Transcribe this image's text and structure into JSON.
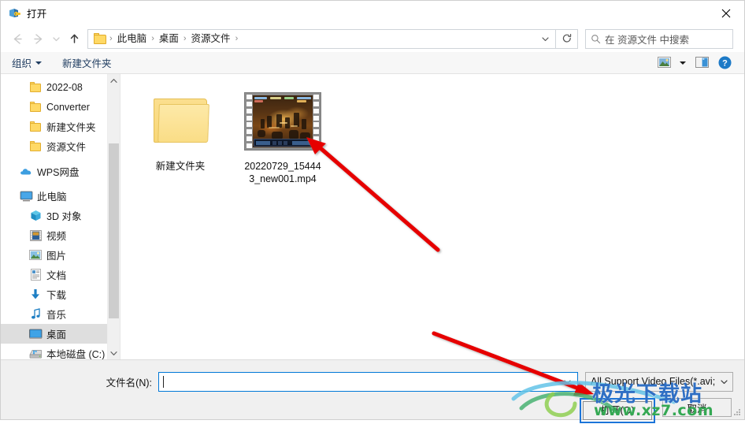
{
  "window": {
    "title": "打开",
    "title_icon": "open-file-icon",
    "close_label": "✕"
  },
  "nav": {
    "back_icon": "arrow-left-icon",
    "forward_icon": "arrow-right-icon",
    "recent_icon": "chevron-down-icon",
    "up_icon": "arrow-up-icon",
    "breadcrumbs": [
      "此电脑",
      "桌面",
      "资源文件"
    ],
    "separator": "›",
    "dropdown_icon": "chevron-down-icon",
    "refresh_icon": "refresh-icon"
  },
  "search": {
    "placeholder": "在 资源文件 中搜索",
    "icon": "search-icon"
  },
  "toolbar": {
    "organize_label": "组织",
    "new_folder_label": "新建文件夹",
    "view_icon": "view-layout-icon",
    "view_caret_icon": "chevron-down-icon",
    "preview_pane_icon": "preview-pane-icon",
    "help_icon": "help-question-icon"
  },
  "sidebar": {
    "items": [
      {
        "label": "2022-08",
        "icon": "folder-icon",
        "level": 2,
        "selected": false
      },
      {
        "label": "Converter",
        "icon": "folder-icon",
        "level": 2,
        "selected": false
      },
      {
        "label": "新建文件夹",
        "icon": "folder-icon",
        "level": 2,
        "selected": false
      },
      {
        "label": "资源文件",
        "icon": "folder-icon",
        "level": 2,
        "selected": false
      },
      {
        "label": "WPS网盘",
        "icon": "cloud-icon",
        "level": 1,
        "selected": false
      },
      {
        "label": "此电脑",
        "icon": "computer-icon",
        "level": 1,
        "selected": false
      },
      {
        "label": "3D 对象",
        "icon": "3d-objects-icon",
        "level": 2,
        "selected": false
      },
      {
        "label": "视频",
        "icon": "videos-icon",
        "level": 2,
        "selected": false
      },
      {
        "label": "图片",
        "icon": "pictures-icon",
        "level": 2,
        "selected": false
      },
      {
        "label": "文档",
        "icon": "documents-icon",
        "level": 2,
        "selected": false
      },
      {
        "label": "下载",
        "icon": "downloads-icon",
        "level": 2,
        "selected": false
      },
      {
        "label": "音乐",
        "icon": "music-icon",
        "level": 2,
        "selected": false
      },
      {
        "label": "桌面",
        "icon": "desktop-icon",
        "level": 2,
        "selected": true
      },
      {
        "label": "本地磁盘 (C:)",
        "icon": "local-disk-icon",
        "level": 2,
        "selected": false
      }
    ],
    "scroll_up_icon": "chevron-up-icon",
    "scroll_down_icon": "chevron-down-icon"
  },
  "files": [
    {
      "name": "新建文件夹",
      "type": "folder",
      "icon": "folder-icon"
    },
    {
      "name": "20220729_154443_new001.mp4",
      "type": "video",
      "icon": "video-thumbnail"
    }
  ],
  "footer": {
    "filename_label": "文件名(N):",
    "filename_value": "",
    "filename_dropdown_icon": "chevron-down-icon",
    "filetype_value": "All Support Video Files(*.avi;",
    "filetype_dropdown_icon": "chevron-down-icon",
    "open_label": "打开(O)",
    "cancel_label": "取消"
  },
  "annotations": {
    "arrow_color": "#e60000",
    "arrow_to_file": "red-arrow-pointing-to-video-file",
    "arrow_to_open": "red-arrow-pointing-to-open-button"
  },
  "watermark": {
    "text": "极光下载站",
    "url": "www.xz7.com"
  },
  "colors": {
    "accent": "#0078d7",
    "highlight_border": "#1b74d8",
    "folder": "#ffd965",
    "selection": "#dedede"
  }
}
